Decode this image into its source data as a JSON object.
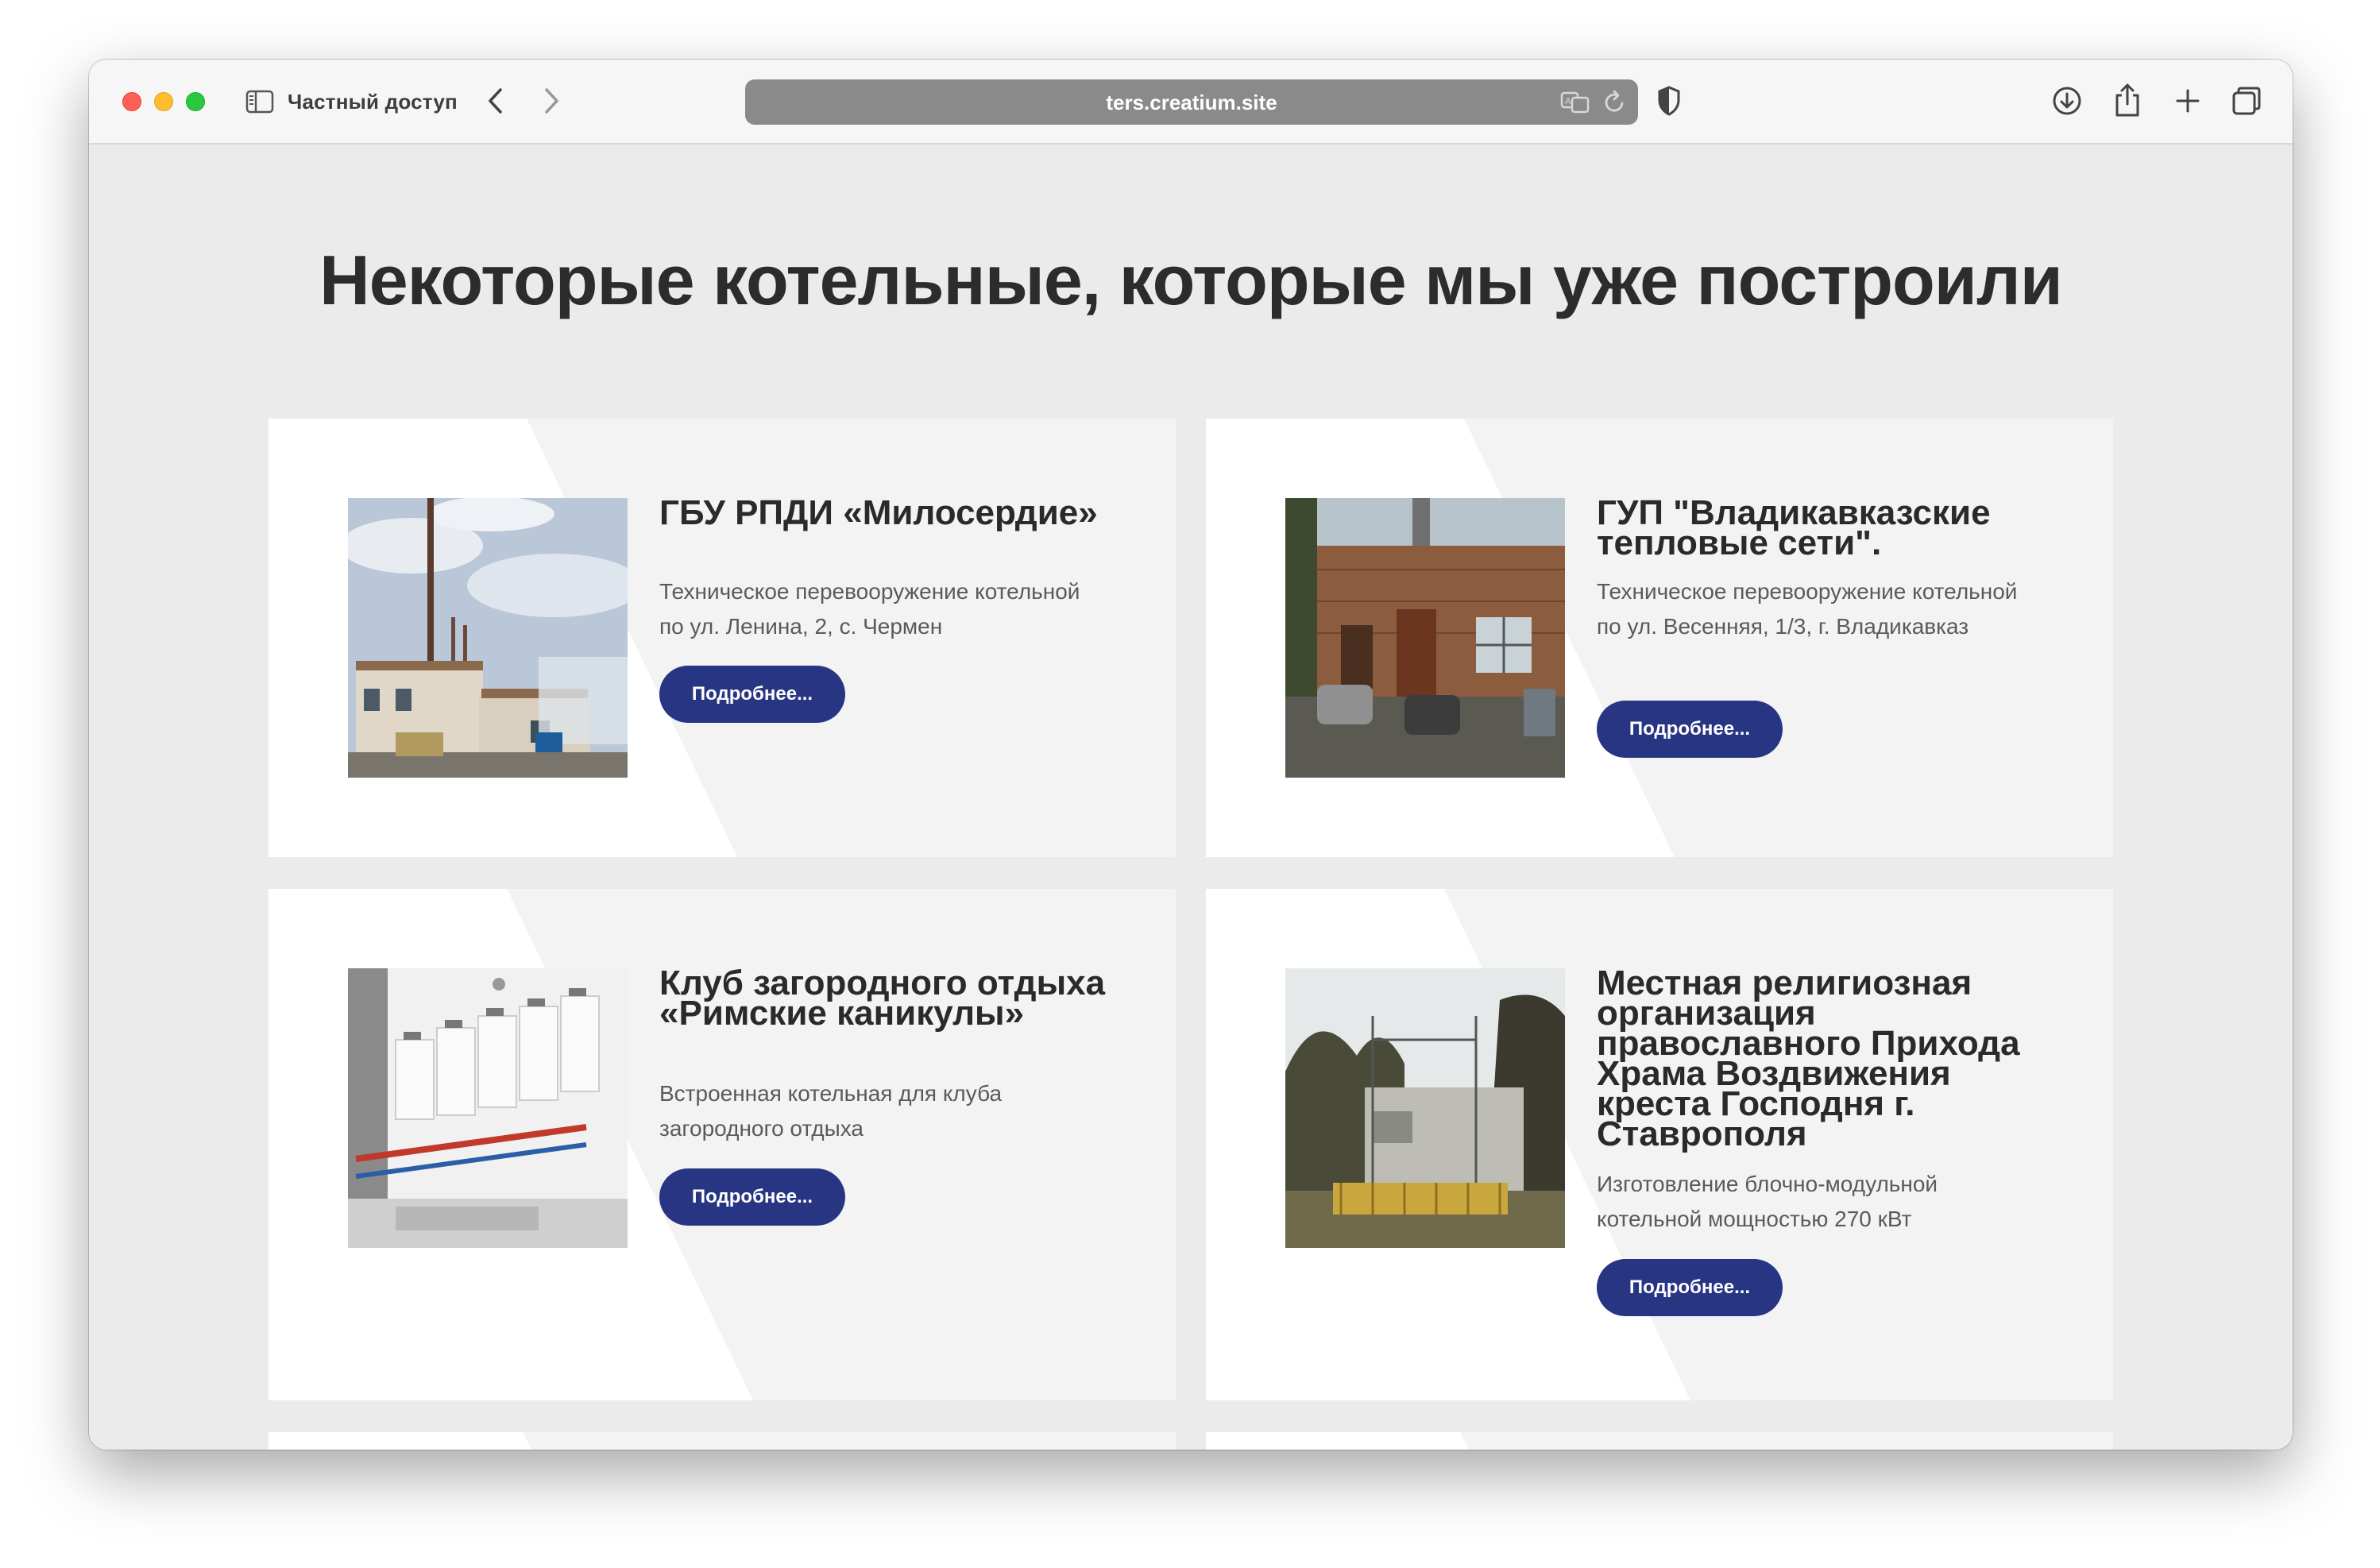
{
  "browser": {
    "private_label": "Частный доступ",
    "url": "ters.creatium.site",
    "icons": [
      "sidebar-icon",
      "back-icon",
      "forward-icon",
      "translate-icon",
      "reload-icon",
      "shield-icon",
      "download-icon",
      "share-icon",
      "new-tab-icon",
      "tabs-overview-icon"
    ]
  },
  "page": {
    "heading": "Некоторые котельные, которые мы уже построили",
    "accent_color": "#283582",
    "cards": [
      {
        "title": "ГБУ РПДИ «Милосердие»",
        "description": "Техническое перевооружение котельной по ул. Ленина, 2, с. Чермен",
        "button": "Подробнее..."
      },
      {
        "title": "ГУП \"Владикавказские тепловые сети\".",
        "description": "Техническое перевооружение котельной по ул. Весенняя, 1/3, г. Владикавказ",
        "button": "Подробнее..."
      },
      {
        "title": "Клуб загородного отдыха «Римские каникулы»",
        "description": "Встроенная котельная для клуба загородного отдыха",
        "button": "Подробнее..."
      },
      {
        "title": "Местная религиозная организация православного Прихода Храма Воздвижения креста Господня г. Ставрополя",
        "description": "Изготовление блочно-модульной котельной мощностью 270 кВт",
        "button": "Подробнее..."
      }
    ]
  }
}
